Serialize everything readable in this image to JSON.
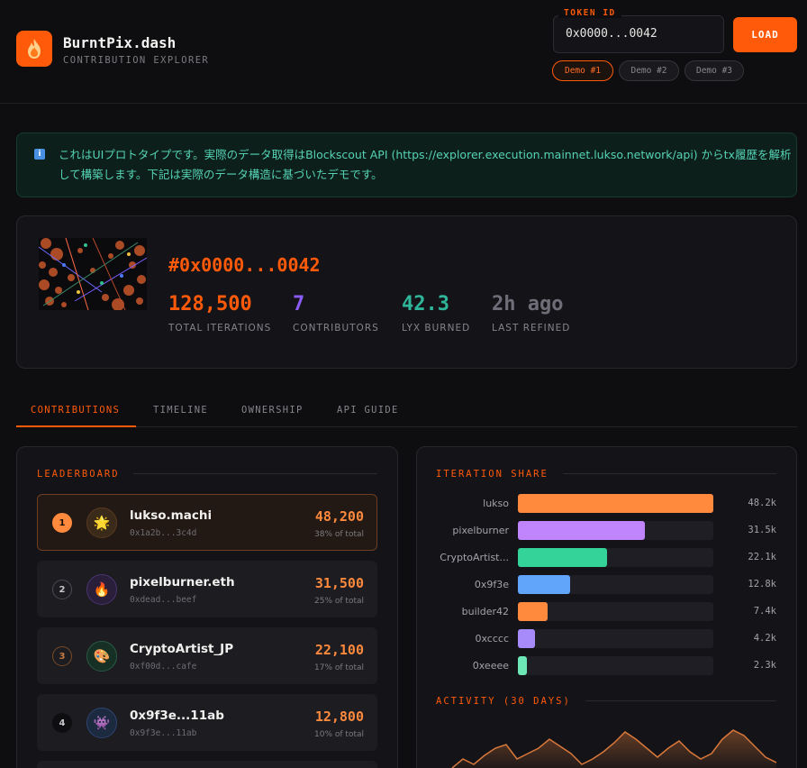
{
  "header": {
    "brand": "BurntPix.dash",
    "subtitle": "CONTRIBUTION EXPLORER",
    "token_label": "TOKEN ID",
    "token_value": "0x0000...0042",
    "load_label": "LOAD",
    "demos": [
      "Demo #1",
      "Demo #2",
      "Demo #3"
    ]
  },
  "info": {
    "text": "これはUIプロトタイプです。実際のデータ取得はBlockscout API (https://explorer.execution.mainnet.lukso.network/api) からtx履歴を解析して構築します。下記は実際のデータ構造に基づいたデモです。"
  },
  "token": {
    "title": "#0x0000...0042",
    "stats": [
      {
        "value": "128,500",
        "label": "TOTAL ITERATIONS",
        "color": "#ff5a0a"
      },
      {
        "value": "7",
        "label": "CONTRIBUTORS",
        "color": "#8b5cf6"
      },
      {
        "value": "42.3",
        "label": "LYX BURNED",
        "color": "#2fb59a"
      },
      {
        "value": "2h ago",
        "label": "LAST REFINED",
        "color": "#6f6d78"
      }
    ]
  },
  "tabs": [
    "CONTRIBUTIONS",
    "TIMELINE",
    "OWNERSHIP",
    "API GUIDE"
  ],
  "leaderboard": {
    "title": "LEADERBOARD",
    "rows": [
      {
        "rank": "1",
        "name": "lukso.machi",
        "addr": "0x1a2b...3c4d",
        "value": "48,200",
        "pct": "38% of total",
        "icon": "🌟"
      },
      {
        "rank": "2",
        "name": "pixelburner.eth",
        "addr": "0xdead...beef",
        "value": "31,500",
        "pct": "25% of total",
        "icon": "🔥"
      },
      {
        "rank": "3",
        "name": "CryptoArtist_JP",
        "addr": "0xf00d...cafe",
        "value": "22,100",
        "pct": "17% of total",
        "icon": "🎨"
      },
      {
        "rank": "4",
        "name": "0x9f3e...11ab",
        "addr": "0x9f3e...11ab",
        "value": "12,800",
        "pct": "10% of total",
        "icon": "👾"
      }
    ]
  },
  "share": {
    "title": "ITERATION SHARE",
    "bars": [
      {
        "label": "lukso",
        "value": "48.2k",
        "fraction": 1.0,
        "color": "#ff8a3d"
      },
      {
        "label": "pixelburner",
        "value": "31.5k",
        "fraction": 0.65,
        "color": "#c084fc"
      },
      {
        "label": "CryptoArtist...",
        "value": "22.1k",
        "fraction": 0.455,
        "color": "#34d399"
      },
      {
        "label": "0x9f3e",
        "value": "12.8k",
        "fraction": 0.265,
        "color": "#60a5fa"
      },
      {
        "label": "builder42",
        "value": "7.4k",
        "fraction": 0.153,
        "color": "#ff8a3d"
      },
      {
        "label": "0xcccc",
        "value": "4.2k",
        "fraction": 0.087,
        "color": "#a78bfa"
      },
      {
        "label": "0xeeee",
        "value": "2.3k",
        "fraction": 0.048,
        "color": "#6ee7b7"
      }
    ]
  },
  "activity": {
    "title": "ACTIVITY (30 DAYS)"
  }
}
